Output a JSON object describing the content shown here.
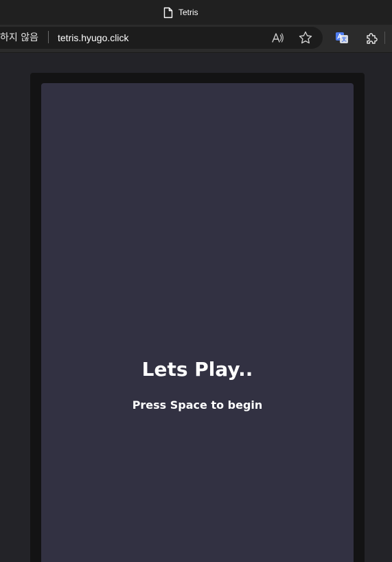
{
  "window": {
    "title": "Tetris",
    "page_icon": "document-icon"
  },
  "toolbar": {
    "security_label": "하지 않음",
    "url": "tetris.hyugo.click",
    "icons": [
      "read-aloud-icon",
      "favorite-star-icon",
      "translate-icon",
      "extensions-icon"
    ]
  },
  "game": {
    "headline": "Lets Play..",
    "instruction": "Press Space to begin"
  },
  "colors": {
    "titlebar": "#202020",
    "toolbar": "#2b2b2b",
    "address_bar": "#1c1c1c",
    "page_background": "#232328",
    "game_frame": "#131314",
    "game_board": "#323142",
    "text": "#ffffff"
  }
}
